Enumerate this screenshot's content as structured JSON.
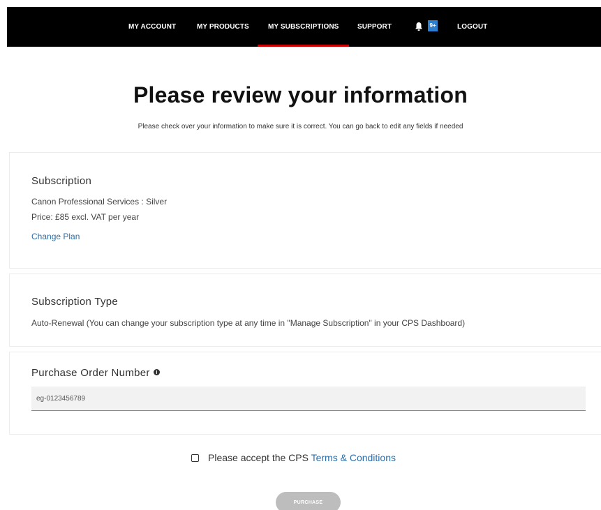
{
  "nav": {
    "items": [
      {
        "label": "MY ACCOUNT"
      },
      {
        "label": "MY PRODUCTS"
      },
      {
        "label": "MY SUBSCRIPTIONS"
      },
      {
        "label": "SUPPORT"
      }
    ],
    "notification_badge": "9+",
    "logout_label": "LOGOUT",
    "active_item": "MY SUBSCRIPTIONS",
    "background_color": "#000000",
    "active_underline_color": "#cc0000"
  },
  "header": {
    "title": "Please review your information",
    "subtitle": "Please check over your information to make sure it is correct. You can go back to edit any fields if needed"
  },
  "subscription": {
    "title": "Subscription",
    "plan": "Canon Professional Services : Silver",
    "price": "Price: £85 excl. VAT per year",
    "change_plan_label": "Change Plan"
  },
  "subscription_type": {
    "title": "Subscription Type",
    "description": "Auto-Renewal (You can change your subscription type at any time in \"Manage Subscription\" in your CPS Dashboard)"
  },
  "purchase_order": {
    "title": "Purchase Order Number",
    "placeholder": "eg-0123456789",
    "value": ""
  },
  "terms": {
    "prefix": "Please accept the CPS ",
    "link_label": "Terms & Conditions",
    "checked": false
  },
  "purchase_button": {
    "label": "PURCHASE",
    "state": "disabled"
  },
  "colors": {
    "link": "#2c6ea8",
    "badge": "#2a7fd1",
    "button_disabled": "#bdbdbd"
  },
  "icons": {
    "bell": "bell-icon",
    "info": "info-icon",
    "checkbox": "checkbox-unchecked"
  }
}
